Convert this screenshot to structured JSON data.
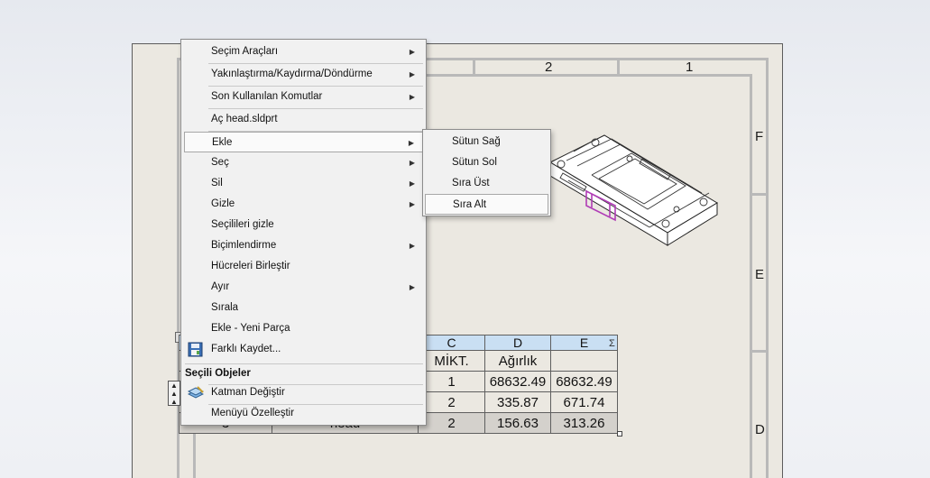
{
  "sheet": {
    "zones_top": [
      "2",
      "1"
    ],
    "zones_right": [
      "F",
      "E",
      "D"
    ]
  },
  "table": {
    "headers": [
      "C",
      "D",
      "E"
    ],
    "subheaders": [
      "MİKT.",
      "Ağırlık",
      ""
    ],
    "rows": [
      {
        "qty": "1",
        "weight": "68632.49",
        "total": "68632.49"
      },
      {
        "qty": "2",
        "weight": "335.87",
        "total": "671.74"
      },
      {
        "qty": "2",
        "weight": "156.63",
        "total": "313.26"
      }
    ],
    "partial_row_num": "3",
    "partial_row_name": "head",
    "sigma": "Σ"
  },
  "context_menu": {
    "items": [
      {
        "label": "Seçim Araçları",
        "submenu": true
      },
      {
        "label": "Yakınlaştırma/Kaydırma/Döndürme",
        "submenu": true
      },
      {
        "label": "Son Kullanılan Komutlar",
        "submenu": true
      },
      {
        "label": "Aç head.sldprt",
        "submenu": false
      },
      {
        "label": "Ekle",
        "submenu": true
      },
      {
        "label": "Seç",
        "submenu": true
      },
      {
        "label": "Sil",
        "submenu": true
      },
      {
        "label": "Gizle",
        "submenu": true
      },
      {
        "label": "Seçilileri gizle",
        "submenu": false
      },
      {
        "label": "Biçimlendirme",
        "submenu": true
      },
      {
        "label": "Hücreleri Birleştir",
        "submenu": false
      },
      {
        "label": "Ayır",
        "submenu": true
      },
      {
        "label": "Sırala",
        "submenu": false
      },
      {
        "label": "Ekle - Yeni Parça",
        "submenu": false
      },
      {
        "label": "Farklı Kaydet...",
        "submenu": false,
        "icon": "save-as-icon"
      }
    ],
    "section_header": "Seçili Objeler",
    "section_items": [
      {
        "label": "Katman Değiştir",
        "icon": "layer-icon"
      },
      {
        "label": "Menüyü Özelleştir"
      }
    ]
  },
  "submenu": {
    "items": [
      "Sütun Sağ",
      "Sütun Sol",
      "Sıra Üst",
      "Sıra Alt"
    ]
  }
}
